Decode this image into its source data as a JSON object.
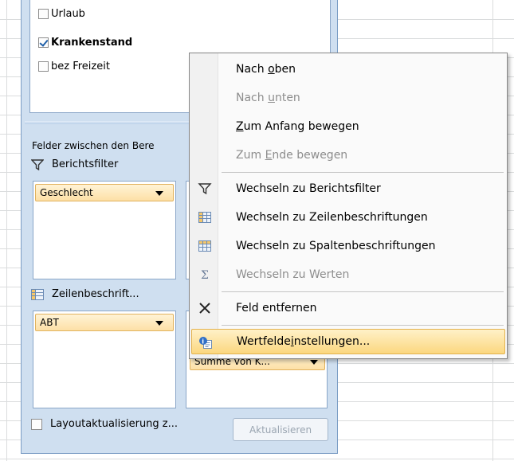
{
  "field_list": {
    "fields": [
      {
        "label": "Urlaub",
        "checked": false,
        "bold": false
      },
      {
        "label": "Krankenstand",
        "checked": true,
        "bold": true
      },
      {
        "label": "bez Freizeit",
        "checked": false,
        "bold": false
      }
    ]
  },
  "areas": {
    "drag_label": "Felder zwischen den Bere",
    "report_filter": {
      "title": "Berichtsfilter",
      "chip": "Geschlecht"
    },
    "row_labels": {
      "title": "Zeilenbeschrift...",
      "chip": "ABT"
    },
    "values": {
      "chip": "Summe von K..."
    }
  },
  "footer": {
    "defer_label": "Layoutaktualisierung z...",
    "defer_checked": false,
    "update_button": "Aktualisieren"
  },
  "context_menu": {
    "items": [
      {
        "pre": "Nach ",
        "u": "o",
        "post": "ben",
        "disabled": false,
        "icon": ""
      },
      {
        "pre": "Nach ",
        "u": "u",
        "post": "nten",
        "disabled": true,
        "icon": ""
      },
      {
        "pre": "",
        "u": "Z",
        "post": "um Anfang bewegen",
        "disabled": false,
        "icon": ""
      },
      {
        "pre": "Zum ",
        "u": "E",
        "post": "nde bewegen",
        "disabled": true,
        "icon": ""
      },
      {
        "pre": "Wechseln zu Berichtsfilter",
        "u": "",
        "post": "",
        "disabled": false,
        "icon": "filter-icon"
      },
      {
        "pre": "Wechseln zu Zeilenbeschriftungen",
        "u": "",
        "post": "",
        "disabled": false,
        "icon": "row-labels-icon"
      },
      {
        "pre": "Wechseln zu Spaltenbeschriftungen",
        "u": "",
        "post": "",
        "disabled": false,
        "icon": "column-labels-icon"
      },
      {
        "pre": "Wechseln zu Werten",
        "u": "",
        "post": "",
        "disabled": true,
        "icon": "sigma-icon"
      },
      {
        "pre": "Feld entfernen",
        "u": "",
        "post": "",
        "disabled": false,
        "icon": "remove-x-icon"
      },
      {
        "pre": "Wertfelde",
        "u": "i",
        "post": "nstellungen...",
        "disabled": false,
        "icon": "value-field-settings-icon",
        "highlighted": true
      }
    ]
  },
  "colors": {
    "pane_bg": "#cfdff0",
    "chip_border": "#e1b25d",
    "highlight_border": "#e3b24d"
  }
}
